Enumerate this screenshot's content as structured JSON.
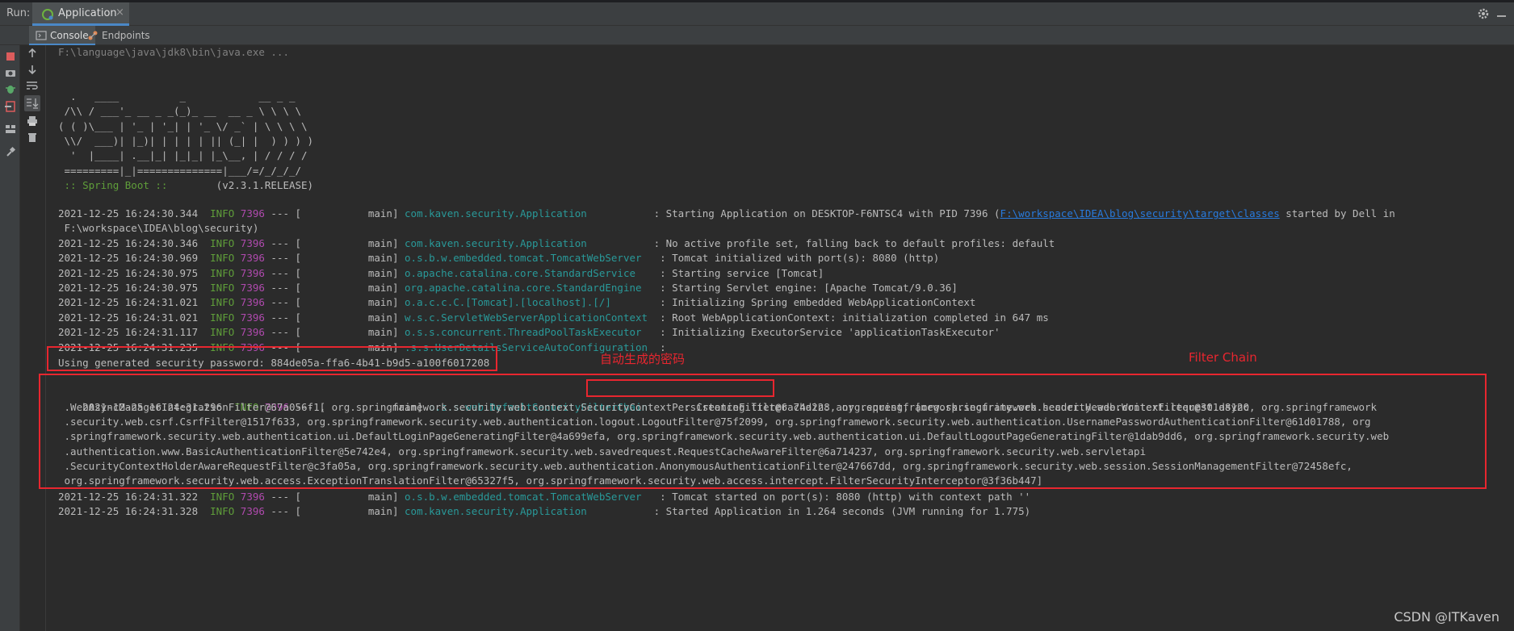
{
  "run_bar": {
    "label": "Run:",
    "tab_label": "Application",
    "close_glyph": "×"
  },
  "subtabs": {
    "console": "Console",
    "endpoints": "Endpoints"
  },
  "icons": {
    "toolbar_left": [
      "rerun-icon",
      "stop-icon",
      "camera-icon",
      "debug-icon",
      "exit-icon",
      "layout-icon",
      "pin-icon"
    ],
    "toolbar_console": [
      "up-arrow-icon",
      "down-arrow-icon",
      "soft-wrap-icon",
      "scroll-to-end-icon",
      "print-icon",
      "trash-icon"
    ]
  },
  "colors": {
    "background": "#2b2b2b",
    "info": "#5f9e3a",
    "pid": "#b04aae",
    "logger": "#299999",
    "link": "#287bde",
    "annotation": "#e8262f"
  },
  "console": {
    "command": "F:\\language\\java\\jdk8\\bin\\java.exe ...",
    "banner": [
      "  .   ____          _            __ _ _",
      " /\\\\ / ___'_ __ _ _(_)_ __  __ _ \\ \\ \\ \\",
      "( ( )\\___ | '_ | '_| | '_ \\/ _` | \\ \\ \\ \\",
      " \\\\/  ___)| |_)| | | | | || (_| |  ) ) ) )",
      "  '  |____| .__|_| |_|_| |_\\__, | / / / /",
      " =========|_|==============|___/=/_/_/_/"
    ],
    "spring_label": " :: Spring Boot ::",
    "spring_version": "        (v2.3.1.RELEASE)",
    "logs_a": [
      {
        "ts": "2021-12-25 16:24:30.344",
        "level": "INFO",
        "pid": "7396",
        "thread": "           main",
        "logger": "com.kaven.security.Application          ",
        "msg": "Starting Application on DESKTOP-F6NTSC4 with PID 7396 (",
        "link": "F:\\workspace\\IDEA\\blog\\security\\target\\classes",
        "msg_after": " started by Dell in"
      },
      {
        "cont": " F:\\workspace\\IDEA\\blog\\security)"
      },
      {
        "ts": "2021-12-25 16:24:30.346",
        "level": "INFO",
        "pid": "7396",
        "thread": "           main",
        "logger": "com.kaven.security.Application          ",
        "msg": "No active profile set, falling back to default profiles: default"
      },
      {
        "ts": "2021-12-25 16:24:30.969",
        "level": "INFO",
        "pid": "7396",
        "thread": "           main",
        "logger": "o.s.b.w.embedded.tomcat.TomcatWebServer  ",
        "msg": "Tomcat initialized with port(s): 8080 (http)"
      },
      {
        "ts": "2021-12-25 16:24:30.975",
        "level": "INFO",
        "pid": "7396",
        "thread": "           main",
        "logger": "o.apache.catalina.core.StandardService   ",
        "msg": "Starting service [Tomcat]"
      },
      {
        "ts": "2021-12-25 16:24:30.975",
        "level": "INFO",
        "pid": "7396",
        "thread": "           main",
        "logger": "org.apache.catalina.core.StandardEngine  ",
        "msg": "Starting Servlet engine: [Apache Tomcat/9.0.36]"
      },
      {
        "ts": "2021-12-25 16:24:31.021",
        "level": "INFO",
        "pid": "7396",
        "thread": "           main",
        "logger": "o.a.c.c.C.[Tomcat].[localhost].[/]       ",
        "msg": "Initializing Spring embedded WebApplicationContext"
      },
      {
        "ts": "2021-12-25 16:24:31.021",
        "level": "INFO",
        "pid": "7396",
        "thread": "           main",
        "logger": "w.s.c.ServletWebServerApplicationContext ",
        "msg": "Root WebApplicationContext: initialization completed in 647 ms"
      },
      {
        "ts": "2021-12-25 16:24:31.117",
        "level": "INFO",
        "pid": "7396",
        "thread": "           main",
        "logger": "o.s.s.concurrent.ThreadPoolTaskExecutor  ",
        "msg": "Initializing ExecutorService 'applicationTaskExecutor'"
      },
      {
        "ts": "2021-12-25 16:24:31.235",
        "level": "INFO",
        "pid": "7396",
        "thread": "           main",
        "logger": ".s.s.UserDetailsServiceAutoConfiguration ",
        "msg": ""
      }
    ],
    "password_line": "Using generated security password: 884de05a-ffa6-4b41-b9d5-a100f6017208",
    "filter_first": {
      "ts": "2021-12-25 16:24:31.296",
      "level": "INFO",
      "pid": "7396",
      "thread": "           main",
      "logger": "o.s.s.web.DefaultSecurityFilterChain     ",
      "msg": "Creating filter chain: any request",
      "msg_after": ", [org.springframework.security.web.context.request.async"
    },
    "filter_cont": [
      " .WebAsyncManagerIntegrationFilter@67a056f1, org.springframework.security.web.context.SecurityContextPersistenceFilter@6a74d228, org.springframework.security.web.header.HeaderWriterFilter@301d8120, org.springframework",
      " .security.web.csrf.CsrfFilter@1517f633, org.springframework.security.web.authentication.logout.LogoutFilter@75f2099, org.springframework.security.web.authentication.UsernamePasswordAuthenticationFilter@61d01788, org",
      " .springframework.security.web.authentication.ui.DefaultLoginPageGeneratingFilter@4a699efa, org.springframework.security.web.authentication.ui.DefaultLogoutPageGeneratingFilter@1dab9dd6, org.springframework.security.web",
      " .authentication.www.BasicAuthenticationFilter@5e742e4, org.springframework.security.web.savedrequest.RequestCacheAwareFilter@6a714237, org.springframework.security.web.servletapi",
      " .SecurityContextHolderAwareRequestFilter@c3fa05a, org.springframework.security.web.authentication.AnonymousAuthenticationFilter@247667dd, org.springframework.security.web.session.SessionManagementFilter@72458efc,",
      " org.springframework.security.web.access.ExceptionTranslationFilter@65327f5, org.springframework.security.web.access.intercept.FilterSecurityInterceptor@3f36b447]"
    ],
    "logs_b": [
      {
        "ts": "2021-12-25 16:24:31.322",
        "level": "INFO",
        "pid": "7396",
        "thread": "           main",
        "logger": "o.s.b.w.embedded.tomcat.TomcatWebServer  ",
        "msg": "Tomcat started on port(s): 8080 (http) with context path ''"
      },
      {
        "ts": "2021-12-25 16:24:31.328",
        "level": "INFO",
        "pid": "7396",
        "thread": "           main",
        "logger": "com.kaven.security.Application          ",
        "msg": "Started Application in 1.264 seconds (JVM running for 1.775)"
      }
    ]
  },
  "annotations": {
    "password": "自动生成的密码",
    "filter_chain": "Filter Chain"
  },
  "watermark": "CSDN @ITKaven"
}
